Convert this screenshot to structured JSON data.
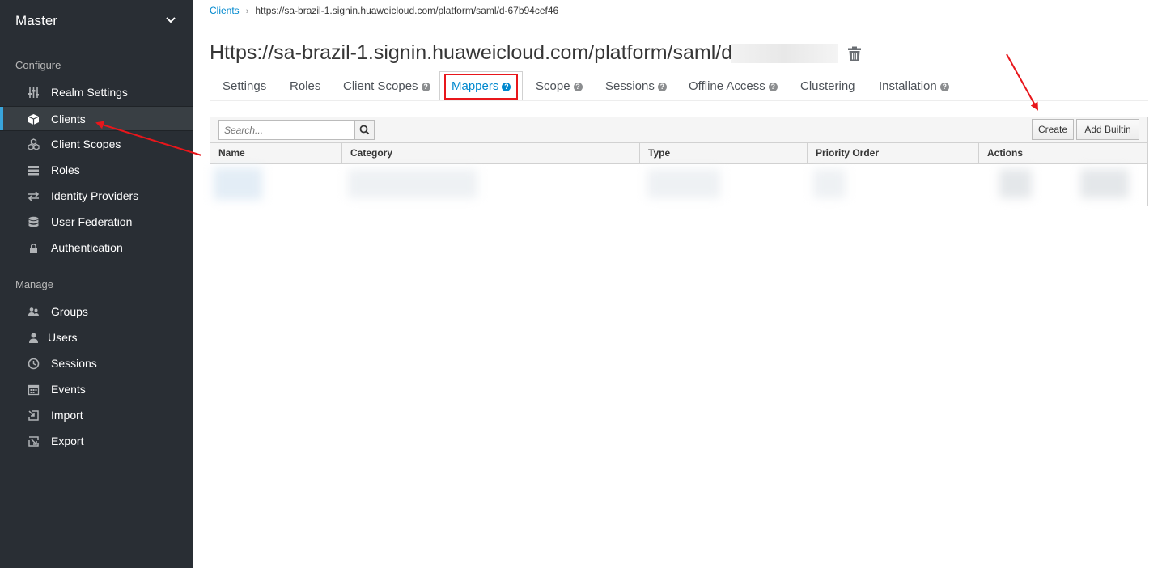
{
  "sidebar": {
    "realm": "Master",
    "sections": {
      "configure": "Configure",
      "manage": "Manage"
    },
    "configure_items": [
      {
        "label": "Realm Settings",
        "icon": "sliders-icon"
      },
      {
        "label": "Clients",
        "icon": "cube-icon",
        "active": true
      },
      {
        "label": "Client Scopes",
        "icon": "cubes-icon"
      },
      {
        "label": "Roles",
        "icon": "list-icon"
      },
      {
        "label": "Identity Providers",
        "icon": "exchange-icon"
      },
      {
        "label": "User Federation",
        "icon": "database-icon"
      },
      {
        "label": "Authentication",
        "icon": "lock-icon"
      }
    ],
    "manage_items": [
      {
        "label": "Groups",
        "icon": "users-icon"
      },
      {
        "label": "Users",
        "icon": "user-icon"
      },
      {
        "label": "Sessions",
        "icon": "clock-icon"
      },
      {
        "label": "Events",
        "icon": "calendar-icon"
      },
      {
        "label": "Import",
        "icon": "import-icon"
      },
      {
        "label": "Export",
        "icon": "export-icon"
      }
    ]
  },
  "breadcrumb": {
    "link": "Clients",
    "separator": "›",
    "current": "https://sa-brazil-1.signin.huaweicloud.com/platform/saml/d-67b94cef46"
  },
  "page": {
    "title": "Https://sa-brazil-1.signin.huaweicloud.com/platform/saml/d-"
  },
  "tabs": [
    {
      "label": "Settings",
      "help": false
    },
    {
      "label": "Roles",
      "help": false
    },
    {
      "label": "Client Scopes",
      "help": true
    },
    {
      "label": "Mappers",
      "help": true,
      "active": true
    },
    {
      "label": "Scope",
      "help": true
    },
    {
      "label": "Sessions",
      "help": true
    },
    {
      "label": "Offline Access",
      "help": true
    },
    {
      "label": "Clustering",
      "help": false
    },
    {
      "label": "Installation",
      "help": true
    }
  ],
  "toolbar": {
    "search_placeholder": "Search...",
    "create_label": "Create",
    "add_builtin_label": "Add Builtin"
  },
  "table": {
    "columns": [
      "Name",
      "Category",
      "Type",
      "Priority Order",
      "Actions"
    ]
  },
  "colors": {
    "sidebar_bg": "#292e34",
    "accent": "#0088ce",
    "active_indicator": "#39a5dc",
    "annotation_red": "#e8161b"
  }
}
